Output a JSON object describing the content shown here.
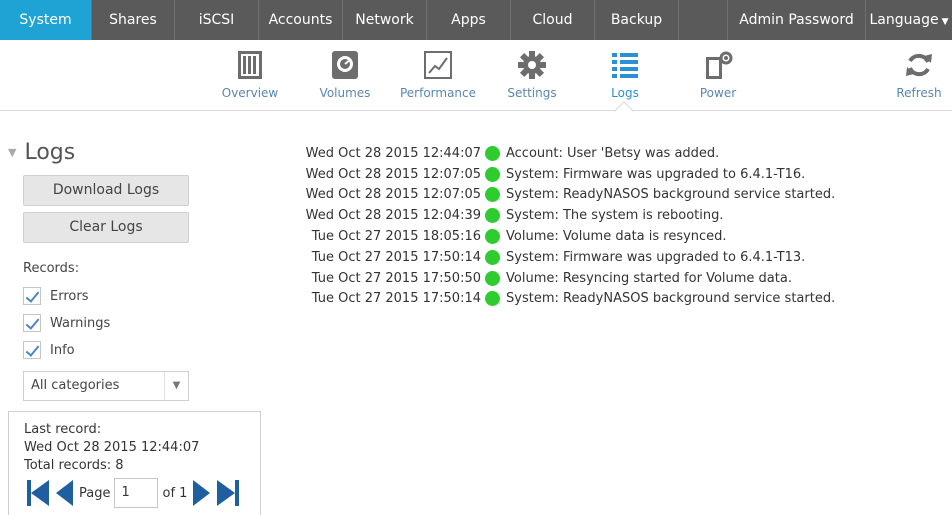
{
  "topnav": {
    "tabs": [
      {
        "label": "System"
      },
      {
        "label": "Shares"
      },
      {
        "label": "iSCSI"
      },
      {
        "label": "Accounts"
      },
      {
        "label": "Network"
      },
      {
        "label": "Apps"
      },
      {
        "label": "Cloud"
      },
      {
        "label": "Backup"
      }
    ],
    "admin_password": "Admin Password",
    "language": "Language",
    "active_tab": "System"
  },
  "subnav": {
    "items": [
      {
        "label": "Overview",
        "icon": "overview-icon"
      },
      {
        "label": "Volumes",
        "icon": "volumes-icon"
      },
      {
        "label": "Performance",
        "icon": "performance-icon"
      },
      {
        "label": "Settings",
        "icon": "gear-icon"
      },
      {
        "label": "Logs",
        "icon": "logs-icon"
      },
      {
        "label": "Power",
        "icon": "power-icon"
      },
      {
        "label": "Refresh",
        "icon": "refresh-icon"
      }
    ],
    "active_item": "Logs"
  },
  "sidebar": {
    "title": "Logs",
    "download_label": "Download Logs",
    "clear_label": "Clear Logs",
    "records_label": "Records:",
    "filters": [
      {
        "label": "Errors",
        "checked": true
      },
      {
        "label": "Warnings",
        "checked": true
      },
      {
        "label": "Info",
        "checked": true
      }
    ],
    "category_selected": "All categories",
    "last_record_label": "Last record:",
    "last_record_value": "Wed Oct 28 2015 12:44:07",
    "total_records": "Total records: 8",
    "pager": {
      "page_label": "Page",
      "page_value": "1",
      "of_label": "of 1"
    }
  },
  "logs": [
    {
      "time": "Wed Oct 28 2015 12:44:07",
      "status": "green",
      "message": "Account: User 'Betsy was added."
    },
    {
      "time": "Wed Oct 28 2015 12:07:05",
      "status": "green",
      "message": "System: Firmware was upgraded to 6.4.1-T16."
    },
    {
      "time": "Wed Oct 28 2015 12:07:05",
      "status": "green",
      "message": "System: ReadyNASOS background service started."
    },
    {
      "time": "Wed Oct 28 2015 12:04:39",
      "status": "green",
      "message": "System: The system is rebooting."
    },
    {
      "time": "Tue Oct 27 2015 18:05:16",
      "status": "green",
      "message": "Volume: Volume data is resynced."
    },
    {
      "time": "Tue Oct 27 2015 17:50:14",
      "status": "green",
      "message": "System: Firmware was upgraded to 6.4.1-T13."
    },
    {
      "time": "Tue Oct 27 2015 17:50:50",
      "status": "green",
      "message": "Volume: Resyncing started for Volume data."
    },
    {
      "time": "Tue Oct 27 2015 17:50:14",
      "status": "green",
      "message": "System: ReadyNASOS background service started."
    }
  ],
  "colors": {
    "accent": "#1fa3d4",
    "nav_bg": "#5a5a5a",
    "status_ok": "#2ecc2e",
    "link": "#5a86b3"
  }
}
